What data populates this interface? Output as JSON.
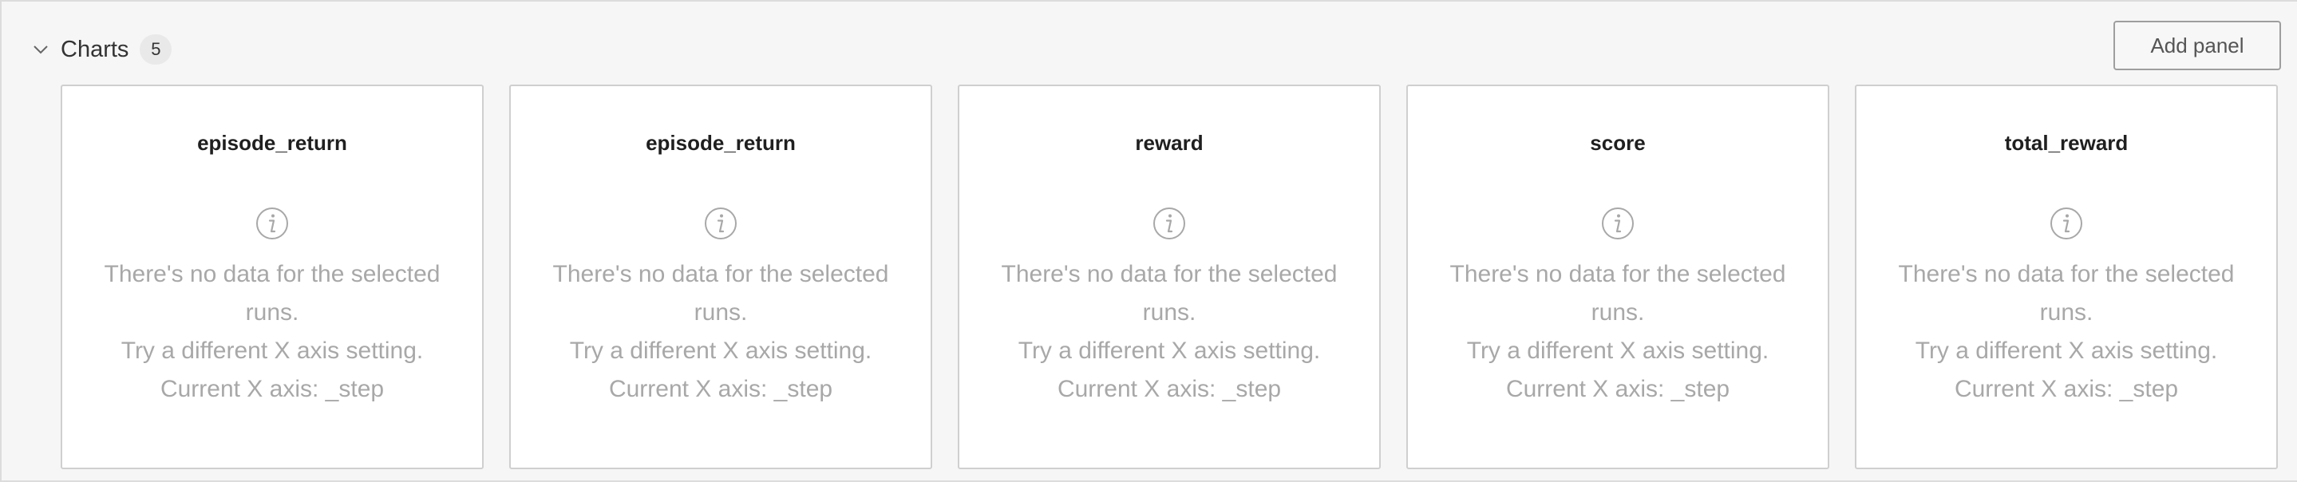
{
  "section": {
    "title": "Charts",
    "count": "5",
    "add_panel_label": "Add panel"
  },
  "panels": [
    {
      "title": "episode_return",
      "line1": "There's no data for the selected",
      "line2": "runs.",
      "line3": "Try a different X axis setting.",
      "line4": "Current X axis: _step"
    },
    {
      "title": "episode_return",
      "line1": "There's no data for the selected",
      "line2": "runs.",
      "line3": "Try a different X axis setting.",
      "line4": "Current X axis: _step"
    },
    {
      "title": "reward",
      "line1": "There's no data for the selected",
      "line2": "runs.",
      "line3": "Try a different X axis setting.",
      "line4": "Current X axis: _step"
    },
    {
      "title": "score",
      "line1": "There's no data for the selected",
      "line2": "runs.",
      "line3": "Try a different X axis setting.",
      "line4": "Current X axis: _step"
    },
    {
      "title": "total_reward",
      "line1": "There's no data for the selected",
      "line2": "runs.",
      "line3": "Try a different X axis setting.",
      "line4": "Current X axis: _step"
    }
  ],
  "icons": {
    "collapse": "chevron-down-icon",
    "info": "info-icon"
  },
  "colors": {
    "muted_text": "#a8a8a8",
    "panel_border": "#cfcfcf",
    "background": "#f6f6f6"
  }
}
